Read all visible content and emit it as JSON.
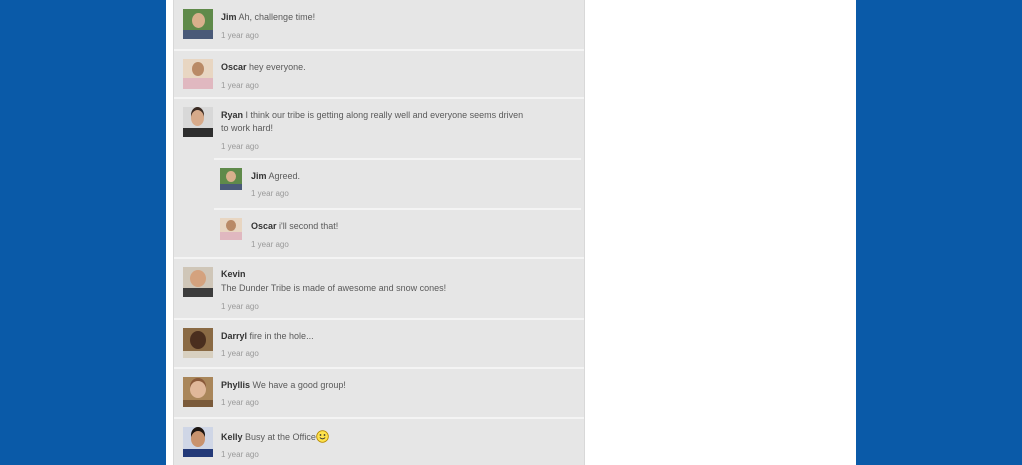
{
  "comments": [
    {
      "author": "Jim",
      "text": "Ah, challenge time!",
      "time": "1 year ago"
    },
    {
      "author": "Oscar",
      "text": "hey everyone.",
      "time": "1 year ago"
    },
    {
      "author": "Ryan",
      "text_line1": "I think our tribe is getting along really well and everyone seems driven",
      "text_line2": "to work hard!",
      "time": "1 year ago",
      "replies": [
        {
          "author": "Jim",
          "text": "Agreed.",
          "time": "1 year ago"
        },
        {
          "author": "Oscar",
          "text": "i'll second that!",
          "time": "1 year ago"
        }
      ]
    },
    {
      "author": "Kevin",
      "text": "The Dunder Tribe is made of awesome and snow cones!",
      "time": "1 year ago"
    },
    {
      "author": "Darryl",
      "text": "fire in the hole...",
      "time": "1 year ago"
    },
    {
      "author": "Phyllis",
      "text": "We have a good group!",
      "time": "1 year ago"
    },
    {
      "author": "Kelly",
      "text": "Busy at the Office",
      "time": "1 year ago",
      "emoji": "smiley-icon"
    }
  ]
}
